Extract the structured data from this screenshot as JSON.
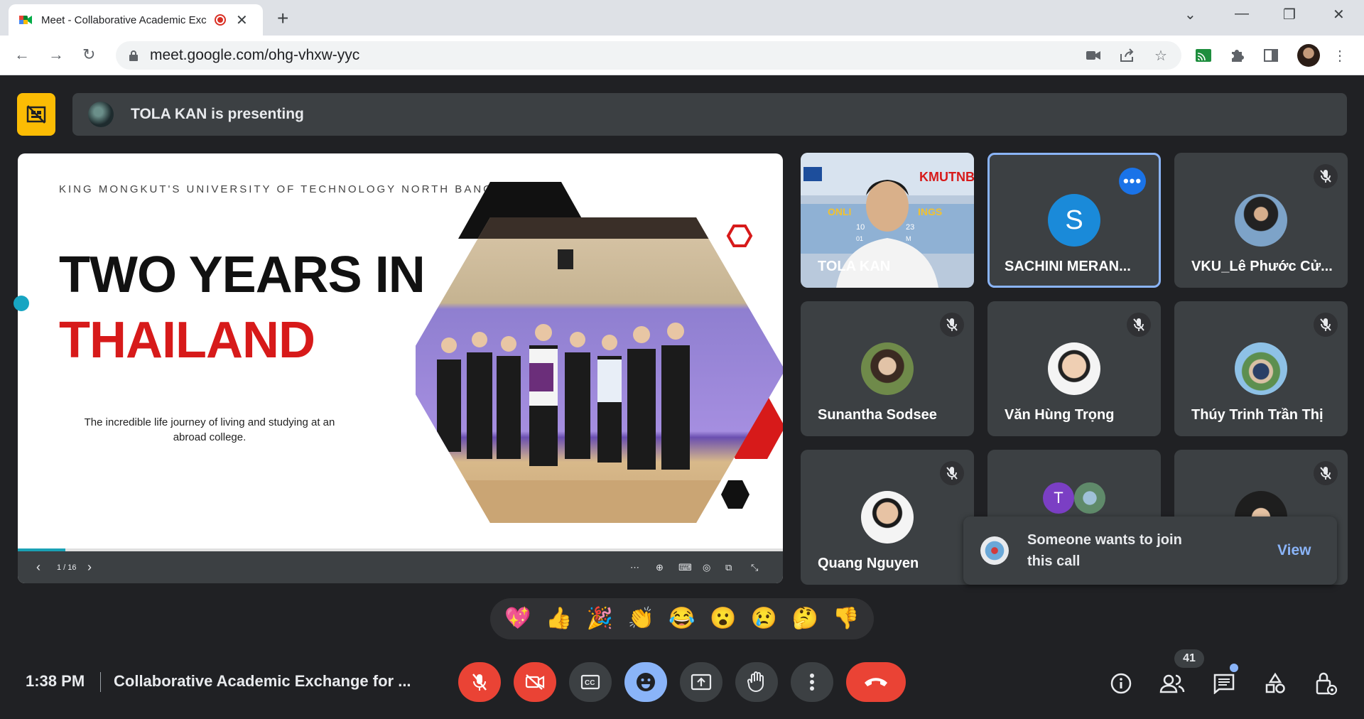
{
  "browser": {
    "tab_title": "Meet - Collaborative Academic Exc",
    "url": "meet.google.com/ohg-vhxw-yyc",
    "new_tab": "+",
    "close_tab": "✕"
  },
  "meeting": {
    "presenting_text": "TOLA KAN is presenting",
    "time": "1:38 PM",
    "title": "Collaborative Academic Exchange for ...",
    "participant_count": "41"
  },
  "slide": {
    "university": "KING MONGKUT'S UNIVERSITY OF TECHNOLOGY NORTH BANGKOK",
    "title_line1": "TWO YEARS IN",
    "title_line2": "THAILAND",
    "subtitle": "The incredible life journey of living and studying at an abroad college.",
    "page_indicator": "1 / 16",
    "progress_fraction": 0.0625,
    "colors": {
      "accent_red": "#d71a1a",
      "progress": "#1aa1b5"
    }
  },
  "participants": [
    {
      "name": "TOLA KAN",
      "video": true
    },
    {
      "name": "SACHINI MERAN...",
      "initial": "S",
      "active": true
    },
    {
      "name": "VKU_Lê Phước Cử..."
    },
    {
      "name": "Sunantha Sodsee"
    },
    {
      "name": "Văn Hùng Trọng"
    },
    {
      "name": "Thúy Trinh Trần Thị"
    },
    {
      "name": "Quang Nguyen"
    },
    {
      "name": "",
      "initial": "T"
    },
    {
      "name": ""
    }
  ],
  "tile_video_text": {
    "online": "ONLI",
    "wings": "INGS",
    "kmutnb": "KMUTNB",
    "num1": "10",
    "num2": "23",
    "num3": "01",
    "num4": "M"
  },
  "toast": {
    "message": "Someone wants to join this call",
    "action": "View"
  },
  "reactions": [
    "💖",
    "👍",
    "🎉",
    "👏",
    "😂",
    "😮",
    "😢",
    "🤔",
    "👎"
  ],
  "icons": {
    "controls": [
      "mic-off-icon",
      "camera-off-icon",
      "captions-icon",
      "emoji-icon",
      "present-icon",
      "raise-hand-icon",
      "more-options-icon",
      "leave-call-icon"
    ],
    "right": [
      "info-icon",
      "people-icon",
      "chat-icon",
      "activities-icon",
      "host-controls-icon"
    ]
  }
}
